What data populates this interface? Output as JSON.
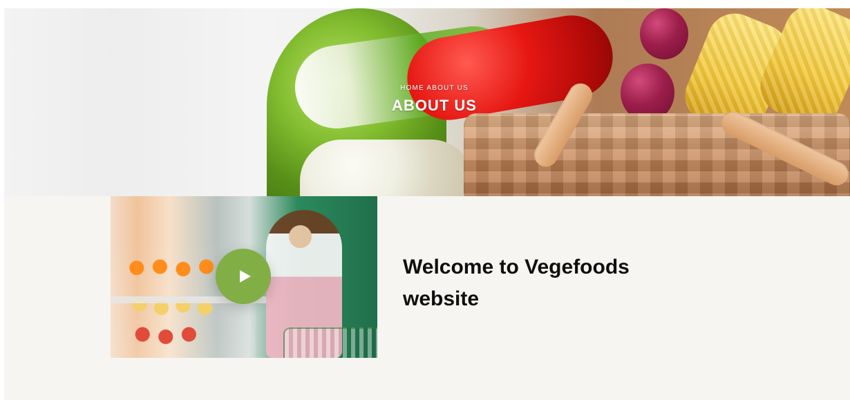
{
  "hero": {
    "breadcrumbs": [
      "Home",
      "About us"
    ],
    "title": "About us"
  },
  "about": {
    "heading": "Welcome to Vegefoods website"
  },
  "colors": {
    "accent": "#82ae46",
    "section_bg": "#f6f5f1",
    "heading_text": "#0f0f0f"
  },
  "icons": {
    "play": "play-icon"
  }
}
